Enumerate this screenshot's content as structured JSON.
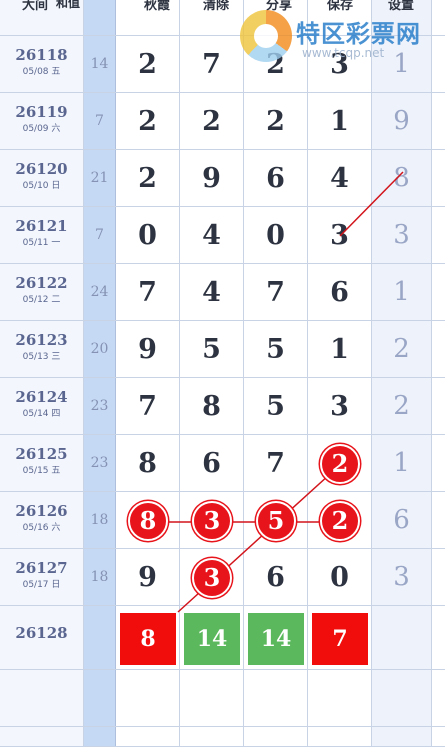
{
  "header": {
    "col_issue": "大间",
    "col_sum": "和值",
    "col_1": "秋霞",
    "col_2": "清除",
    "col_3": "分享",
    "col_4": "保存",
    "col_set": "设置"
  },
  "watermark": {
    "name": "特区彩票网",
    "url": "www.tcqp.net"
  },
  "rows": [
    {
      "issue": "26118",
      "date": "05/08 五",
      "sum": "14",
      "d": [
        "2",
        "7",
        "2",
        "3"
      ],
      "set": "1"
    },
    {
      "issue": "26119",
      "date": "05/09 六",
      "sum": "7",
      "d": [
        "2",
        "2",
        "2",
        "1"
      ],
      "set": "9"
    },
    {
      "issue": "26120",
      "date": "05/10 日",
      "sum": "21",
      "d": [
        "2",
        "9",
        "6",
        "4"
      ],
      "set": "8"
    },
    {
      "issue": "26121",
      "date": "05/11 一",
      "sum": "7",
      "d": [
        "0",
        "4",
        "0",
        "3"
      ],
      "set": "3"
    },
    {
      "issue": "26122",
      "date": "05/12 二",
      "sum": "24",
      "d": [
        "7",
        "4",
        "7",
        "6"
      ],
      "set": "1"
    },
    {
      "issue": "26123",
      "date": "05/13 三",
      "sum": "20",
      "d": [
        "9",
        "5",
        "5",
        "1"
      ],
      "set": "2"
    },
    {
      "issue": "26124",
      "date": "05/14 四",
      "sum": "23",
      "d": [
        "7",
        "8",
        "5",
        "3"
      ],
      "set": "2"
    },
    {
      "issue": "26125",
      "date": "05/15 五",
      "sum": "23",
      "d": [
        "8",
        "6",
        "7",
        "2"
      ],
      "set": "1"
    },
    {
      "issue": "26126",
      "date": "05/16 六",
      "sum": "18",
      "d": [
        "8",
        "3",
        "5",
        "2"
      ],
      "set": "6"
    },
    {
      "issue": "26127",
      "date": "05/17 日",
      "sum": "18",
      "d": [
        "9",
        "3",
        "6",
        "0"
      ],
      "set": "3"
    }
  ],
  "prediction": {
    "issue": "26128",
    "boxes": [
      {
        "value": "8",
        "color": "#f20d0d"
      },
      {
        "value": "14",
        "color": "#5cb85c"
      },
      {
        "value": "14",
        "color": "#5cb85c"
      },
      {
        "value": "7",
        "color": "#f20d0d"
      }
    ]
  },
  "colors": {
    "ball": "#e8141b",
    "line": "#d2141b"
  }
}
